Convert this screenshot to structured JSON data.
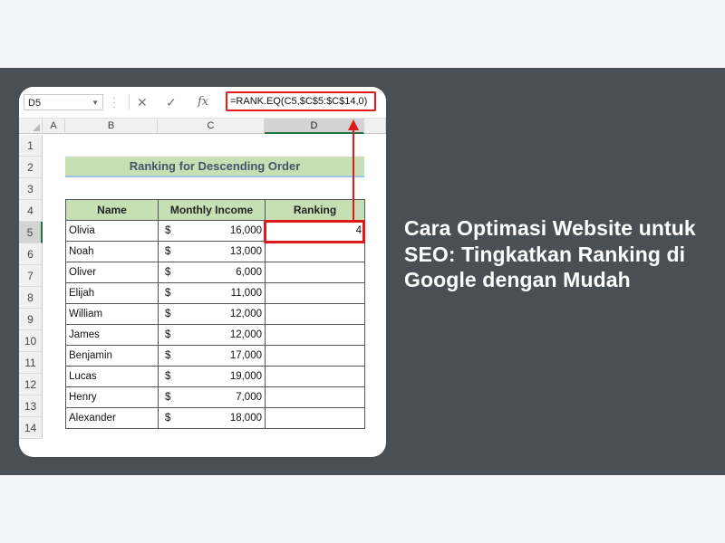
{
  "headline": "Cara Optimasi Website untuk SEO: Tingkatkan Ranking di Google dengan Mudah",
  "formula_bar": {
    "name_box": "D5",
    "dots_icon": "vertical-ellipsis",
    "cancel_icon": "✕",
    "enter_icon": "✓",
    "fx_label": "fx",
    "formula": "=RANK.EQ(C5,$C$5:$C$14,0)"
  },
  "columns": [
    "A",
    "B",
    "C",
    "D"
  ],
  "rows": [
    "1",
    "2",
    "3",
    "4",
    "5",
    "6",
    "7",
    "8",
    "9",
    "10",
    "11",
    "12",
    "13",
    "14"
  ],
  "sheet_title": "Ranking for Descending Order",
  "table": {
    "headers": [
      "Name",
      "Monthly Income",
      "Ranking"
    ],
    "currency": "$",
    "rows": [
      {
        "name": "Olivia",
        "income": "16,000",
        "rank": "4"
      },
      {
        "name": "Noah",
        "income": "13,000",
        "rank": ""
      },
      {
        "name": "Oliver",
        "income": "6,000",
        "rank": ""
      },
      {
        "name": "Elijah",
        "income": "11,000",
        "rank": ""
      },
      {
        "name": "William",
        "income": "12,000",
        "rank": ""
      },
      {
        "name": "James",
        "income": "12,000",
        "rank": ""
      },
      {
        "name": "Benjamin",
        "income": "17,000",
        "rank": ""
      },
      {
        "name": "Lucas",
        "income": "19,000",
        "rank": ""
      },
      {
        "name": "Henry",
        "income": "7,000",
        "rank": ""
      },
      {
        "name": "Alexander",
        "income": "18,000",
        "rank": ""
      }
    ]
  },
  "colors": {
    "band": "#4a4f56",
    "header_fill": "#c6e0b4",
    "highlight": "#e01919",
    "excel_green": "#217346"
  }
}
